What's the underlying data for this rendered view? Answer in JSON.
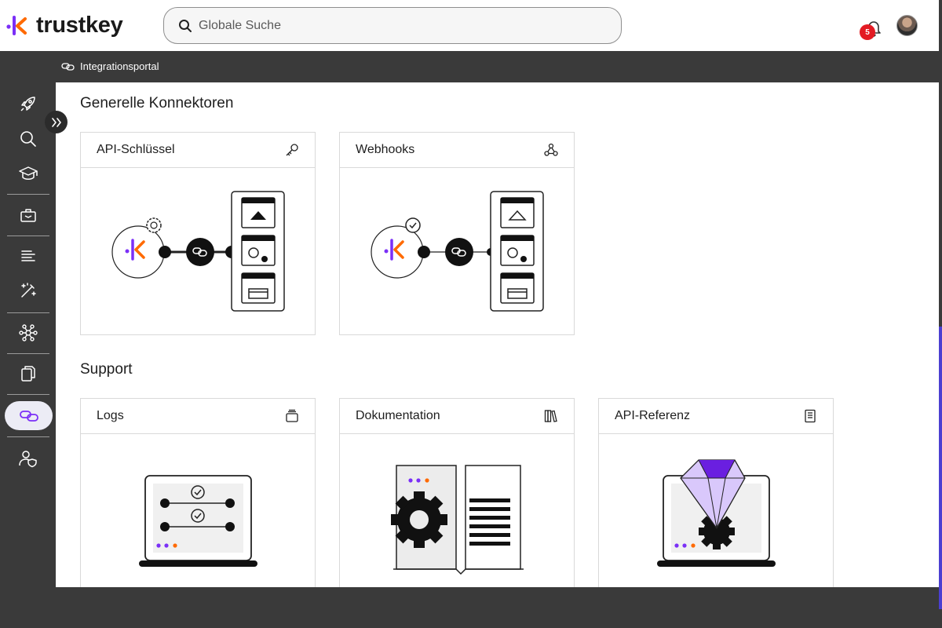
{
  "header": {
    "brand": "trustkey",
    "search": {
      "placeholder": "Globale Suche",
      "value": ""
    },
    "notifications": {
      "count": "5"
    }
  },
  "breadcrumb": {
    "label": "Integrationsportal"
  },
  "sections": {
    "connectors": {
      "title": "Generelle Konnektoren",
      "cards": [
        {
          "title": "API-Schlüssel",
          "icon": "key-icon"
        },
        {
          "title": "Webhooks",
          "icon": "webhook-icon"
        }
      ]
    },
    "support": {
      "title": "Support",
      "cards": [
        {
          "title": "Logs",
          "icon": "stack-icon"
        },
        {
          "title": "Dokumentation",
          "icon": "books-icon"
        },
        {
          "title": "API-Referenz",
          "icon": "book-icon"
        }
      ]
    }
  },
  "sidebar": {
    "items": [
      "rocket-icon",
      "search-icon",
      "graduation-cap-icon",
      "toolbox-icon",
      "list-icon",
      "magic-wand-icon",
      "network-icon",
      "documents-icon",
      "link-icon",
      "user-shield-icon"
    ],
    "active": "link-icon"
  },
  "colors": {
    "accent": "#7b2ff7",
    "orange": "#ff6a00",
    "dark": "#3a3a3a",
    "badge": "#e31b23"
  }
}
